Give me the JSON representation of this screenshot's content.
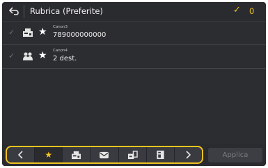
{
  "header": {
    "back_icon": "back-arrow-icon",
    "title": "Rubrica (Preferite)",
    "selected_count": "0",
    "colors": {
      "accent": "#f3c21f",
      "background": "#2c2d31"
    }
  },
  "entries": [
    {
      "type_icon": "fax-icon",
      "favorite_icon": "star-icon",
      "name": "Canon3",
      "value": "789000000000"
    },
    {
      "type_icon": "group-icon",
      "favorite_icon": "star-icon",
      "name": "Canon4",
      "value": "2 dest."
    }
  ],
  "tabs": [
    {
      "icon": "chevron-left-icon"
    },
    {
      "icon": "star-icon",
      "selected": true
    },
    {
      "icon": "fax-icon"
    },
    {
      "icon": "email-icon"
    },
    {
      "icon": "shared-folder-icon"
    },
    {
      "icon": "i-fax-icon"
    },
    {
      "icon": "chevron-right-icon"
    }
  ],
  "apply_label": "Applica"
}
